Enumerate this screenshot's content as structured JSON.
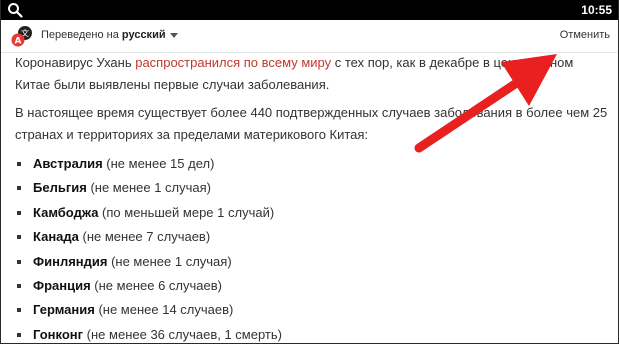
{
  "statusbar": {
    "time": "10:55"
  },
  "translate_bar": {
    "translated_prefix": "Переведено на",
    "language": "русский",
    "cancel_label": "Отменить"
  },
  "article": {
    "p1_a": "Коронавирус Ухань ",
    "p1_link": "распространился по всему миру",
    "p1_b": " с тех пор, как в декабре в центральном Китае были выявлены первые случаи заболевания.",
    "p2": "В настоящее время существует более 440 подтвержденных случаев заболевания в более чем 25 странах и территориях за пределами материкового Китая:",
    "countries": [
      {
        "name": "Австралия",
        "note": " (не менее 15 дел)"
      },
      {
        "name": "Бельгия",
        "note": " (не менее 1 случая)"
      },
      {
        "name": "Камбоджа",
        "note": " (по меньшей мере 1 случай)"
      },
      {
        "name": "Канада",
        "note": " (не менее 7 случаев)"
      },
      {
        "name": "Финляндия",
        "note": " (не менее 1 случая)"
      },
      {
        "name": "Франция",
        "note": " (не менее 6 случаев)"
      },
      {
        "name": "Германия",
        "note": " (не менее 14 случаев)"
      },
      {
        "name": "Гонконг",
        "note": " (не менее 36 случаев, 1 смерть)"
      }
    ]
  },
  "colors": {
    "link": "#c0392b",
    "arrow": "#e8201f",
    "statusbar": "#000000"
  },
  "icons": [
    "search-icon",
    "translate-logo-icon",
    "chevron-down-icon",
    "red-arrow-annotation"
  ]
}
